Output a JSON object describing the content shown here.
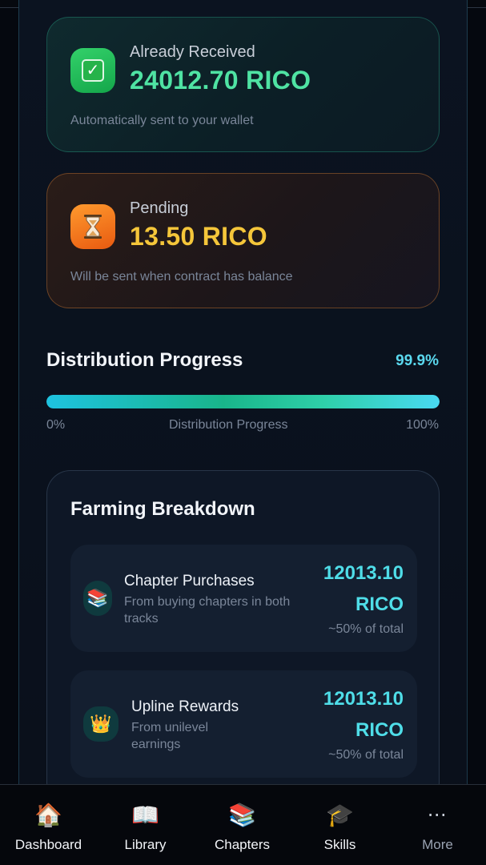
{
  "received": {
    "label": "Already Received",
    "amount": "24012.70 RICO",
    "subtitle": "Automatically sent to your wallet",
    "icon": "check-mark-icon"
  },
  "pending": {
    "label": "Pending",
    "amount": "13.50 RICO",
    "subtitle": "Will be sent when contract has balance",
    "icon": "hourglass-icon"
  },
  "progress": {
    "title": "Distribution Progress",
    "percent_label": "99.9%",
    "value": 0.999,
    "min_label": "0%",
    "center_label": "Distribution Progress",
    "max_label": "100%"
  },
  "breakdown": {
    "title": "Farming Breakdown",
    "items": [
      {
        "title": "Chapter Purchases",
        "subtitle": "From buying chapters in both tracks",
        "amount_value": "12013.10",
        "amount_unit": "RICO",
        "share": "~50% of total",
        "icon": "books-icon"
      },
      {
        "title": "Upline Rewards",
        "subtitle": "From unilevel earnings",
        "amount_value": "12013.10",
        "amount_unit": "RICO",
        "share": "~50% of total",
        "icon": "crown-icon"
      }
    ]
  },
  "nav": {
    "items": [
      {
        "label": "Dashboard",
        "icon": "house-icon"
      },
      {
        "label": "Library",
        "icon": "open-book-icon"
      },
      {
        "label": "Chapters",
        "icon": "books-icon"
      },
      {
        "label": "Skills",
        "icon": "graduation-cap-icon"
      },
      {
        "label": "More",
        "icon": "more-dots-icon"
      }
    ]
  },
  "colors": {
    "accent_green": "#4fe3a3",
    "accent_yellow": "#f5c63a",
    "accent_cyan": "#4fdde8",
    "background": "#0a111d"
  }
}
